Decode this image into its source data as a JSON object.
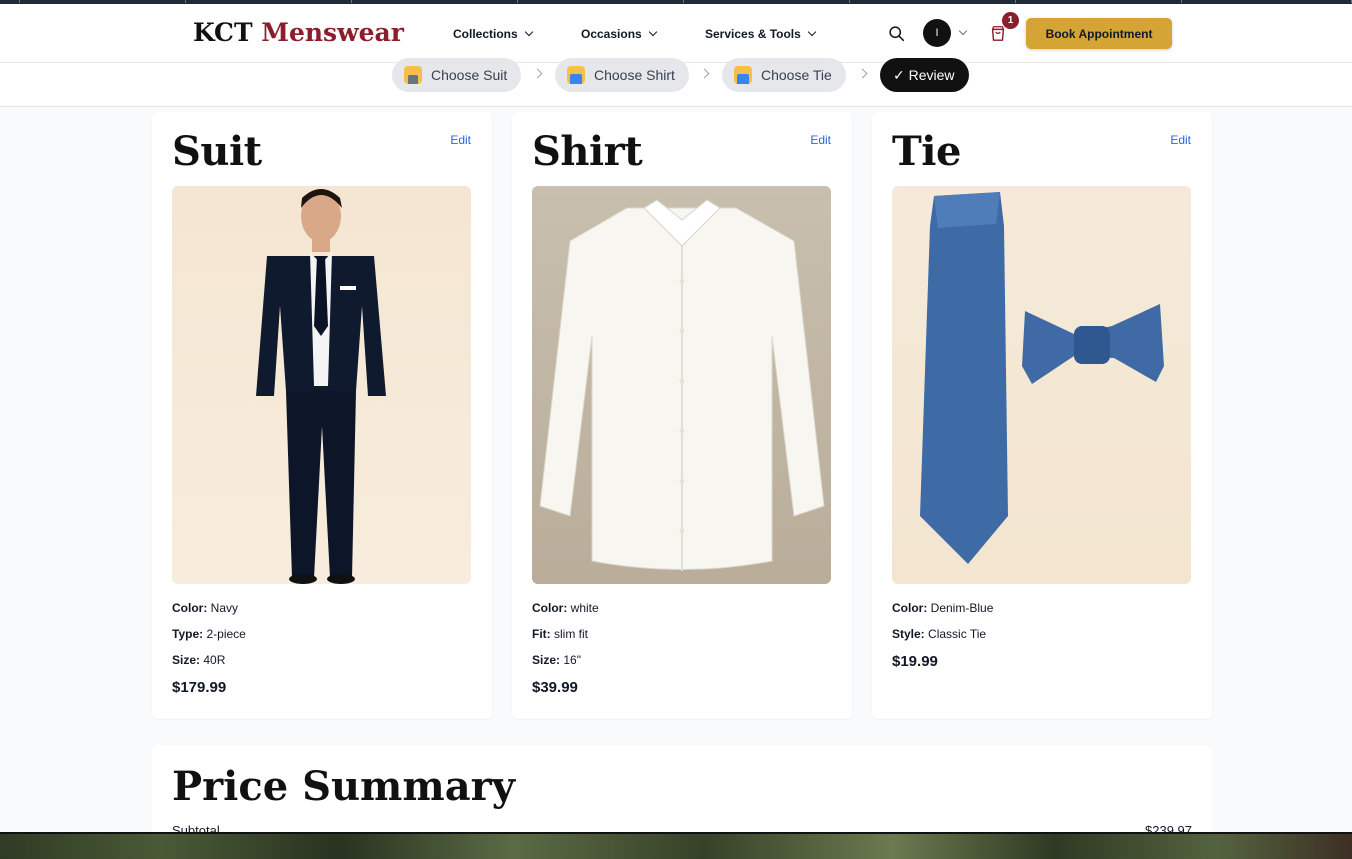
{
  "header": {
    "logo_part1": "KCT",
    "logo_part2": "Menswear",
    "nav": [
      {
        "label": "Collections"
      },
      {
        "label": "Occasions"
      },
      {
        "label": "Services & Tools"
      }
    ],
    "avatar_initial": "I",
    "cart_count": "1",
    "book_button": "Book Appointment"
  },
  "steps": [
    {
      "label": "Choose Suit",
      "icon": "suit-person-icon"
    },
    {
      "label": "Choose Shirt",
      "icon": "shirt-person-icon"
    },
    {
      "label": "Choose Tie",
      "icon": "tie-person-icon"
    },
    {
      "label": "✓ Review",
      "icon": "check-icon"
    }
  ],
  "cards": {
    "suit": {
      "title": "Suit",
      "edit": "Edit",
      "attrs": [
        {
          "k": "Color:",
          "v": "Navy"
        },
        {
          "k": "Type:",
          "v": "2-piece"
        },
        {
          "k": "Size:",
          "v": "40R"
        }
      ],
      "price": "$179.99"
    },
    "shirt": {
      "title": "Shirt",
      "edit": "Edit",
      "attrs": [
        {
          "k": "Color:",
          "v": "white"
        },
        {
          "k": "Fit:",
          "v": "slim fit"
        },
        {
          "k": "Size:",
          "v": "16\""
        }
      ],
      "price": "$39.99"
    },
    "tie": {
      "title": "Tie",
      "edit": "Edit",
      "attrs": [
        {
          "k": "Color:",
          "v": "Denim-Blue"
        },
        {
          "k": "Style:",
          "v": "Classic Tie"
        }
      ],
      "price": "$19.99"
    }
  },
  "summary": {
    "title": "Price Summary",
    "subtotal_label": "Subtotal",
    "subtotal_value": "$239.97"
  },
  "colors": {
    "brand_red": "#8b1d2c",
    "accent_gold": "#d4a535",
    "link_blue": "#2563eb"
  }
}
